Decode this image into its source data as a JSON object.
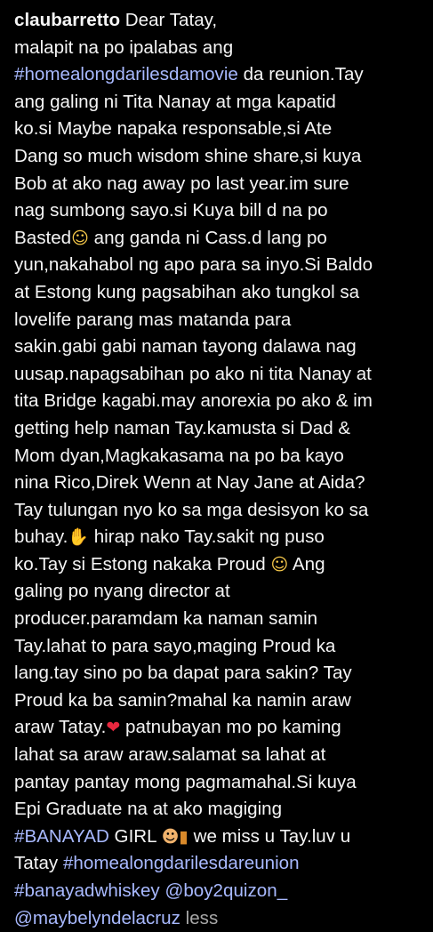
{
  "caption": {
    "username": "claubarretto",
    "l1": " Dear Tatay,",
    "l2": "malapit na po ipalabas ang",
    "l3_tag": "#homealongdarilesdamovie",
    "l3": " da reunion.Tay",
    "l4": "ang galing ni Tita Nanay at mga kapatid",
    "l5": "ko.si Maybe napaka responsable,si Ate",
    "l6": "Dang so much wisdom shine share,si kuya",
    "l7": "Bob at ako nag away po last year.im sure",
    "l8": "nag sumbong sayo.si Kuya bill d na po",
    "l9a": "Basted",
    "l9_emoji": "☺",
    "l9b": " ang ganda ni Cass.d lang po",
    "l10": "yun,nakahabol ng apo para sa inyo.Si Baldo",
    "l11": "at Estong kung pagsabihan ako tungkol sa",
    "l12": "lovelife parang mas matanda para",
    "l13": "sakin.gabi gabi naman tayong dalawa nag",
    "l14": "uusap.napagsabihan po ako ni tita Nanay at",
    "l15": "tita Bridge kagabi.may anorexia po ako & im",
    "l16": "getting help naman Tay.kamusta si Dad &",
    "l17": "Mom dyan,Magkakasama na po ba kayo",
    "l18": "nina Rico,Direk Wenn at Nay Jane at Aida?",
    "l19": "Tay tulungan nyo ko sa mga desisyon ko sa",
    "l20a": "buhay.",
    "l20_emoji": "✋",
    "l20b": " hirap nako Tay.sakit ng puso",
    "l21a": "ko.Tay si Estong nakaka Proud ",
    "l21_emoji": "☺",
    "l21b": " Ang",
    "l22": "galing po nyang director at",
    "l23": "producer.paramdam ka naman samin",
    "l24": "Tay.lahat to para sayo,maging Proud ka",
    "l25": "lang.tay sino po ba dapat para sakin? Tay",
    "l26": "Proud ka ba samin?mahal ka namin araw",
    "l27a": "araw Tatay.",
    "l27_emoji": "❤",
    "l27b": " patnubayan mo po kaming",
    "l28": "lahat sa araw araw.salamat sa lahat at",
    "l29": "pantay pantay mong pagmamahal.Si kuya",
    "l30": "Epi Graduate na at ako magiging",
    "l31_tag": "#BANAYAD",
    "l31a": " GIRL ",
    "l31_emoji1": "☻",
    "l31_emoji2": "▮",
    "l31b": " we miss u Tay.luv u",
    "l32a": "Tatay ",
    "l32_tag": "#homealongdarilesdareunion",
    "l33_tag": "#banayadwhiskey",
    "l33_space": " ",
    "l33_mention": "@boy2quizon_",
    "l34_mention": "@maybelyndelacruz",
    "l34_space": " ",
    "less": "less"
  },
  "icons": {
    "l9_emoji": "laughing-tears-emoji-icon",
    "l20_emoji": "praying-hands-emoji-icon",
    "l21_emoji": "holding-back-tears-emoji-icon",
    "l27_emoji": "red-heart-emoji-icon",
    "l31_emoji1": "boy-emoji-icon",
    "l31_emoji2": "tumbler-glass-emoji-icon"
  },
  "colors": {
    "background": "#000000",
    "text": "#f5f5f5",
    "link": "#a8b9ff",
    "muted": "#a8a8a8",
    "heart": "#e8283f"
  }
}
